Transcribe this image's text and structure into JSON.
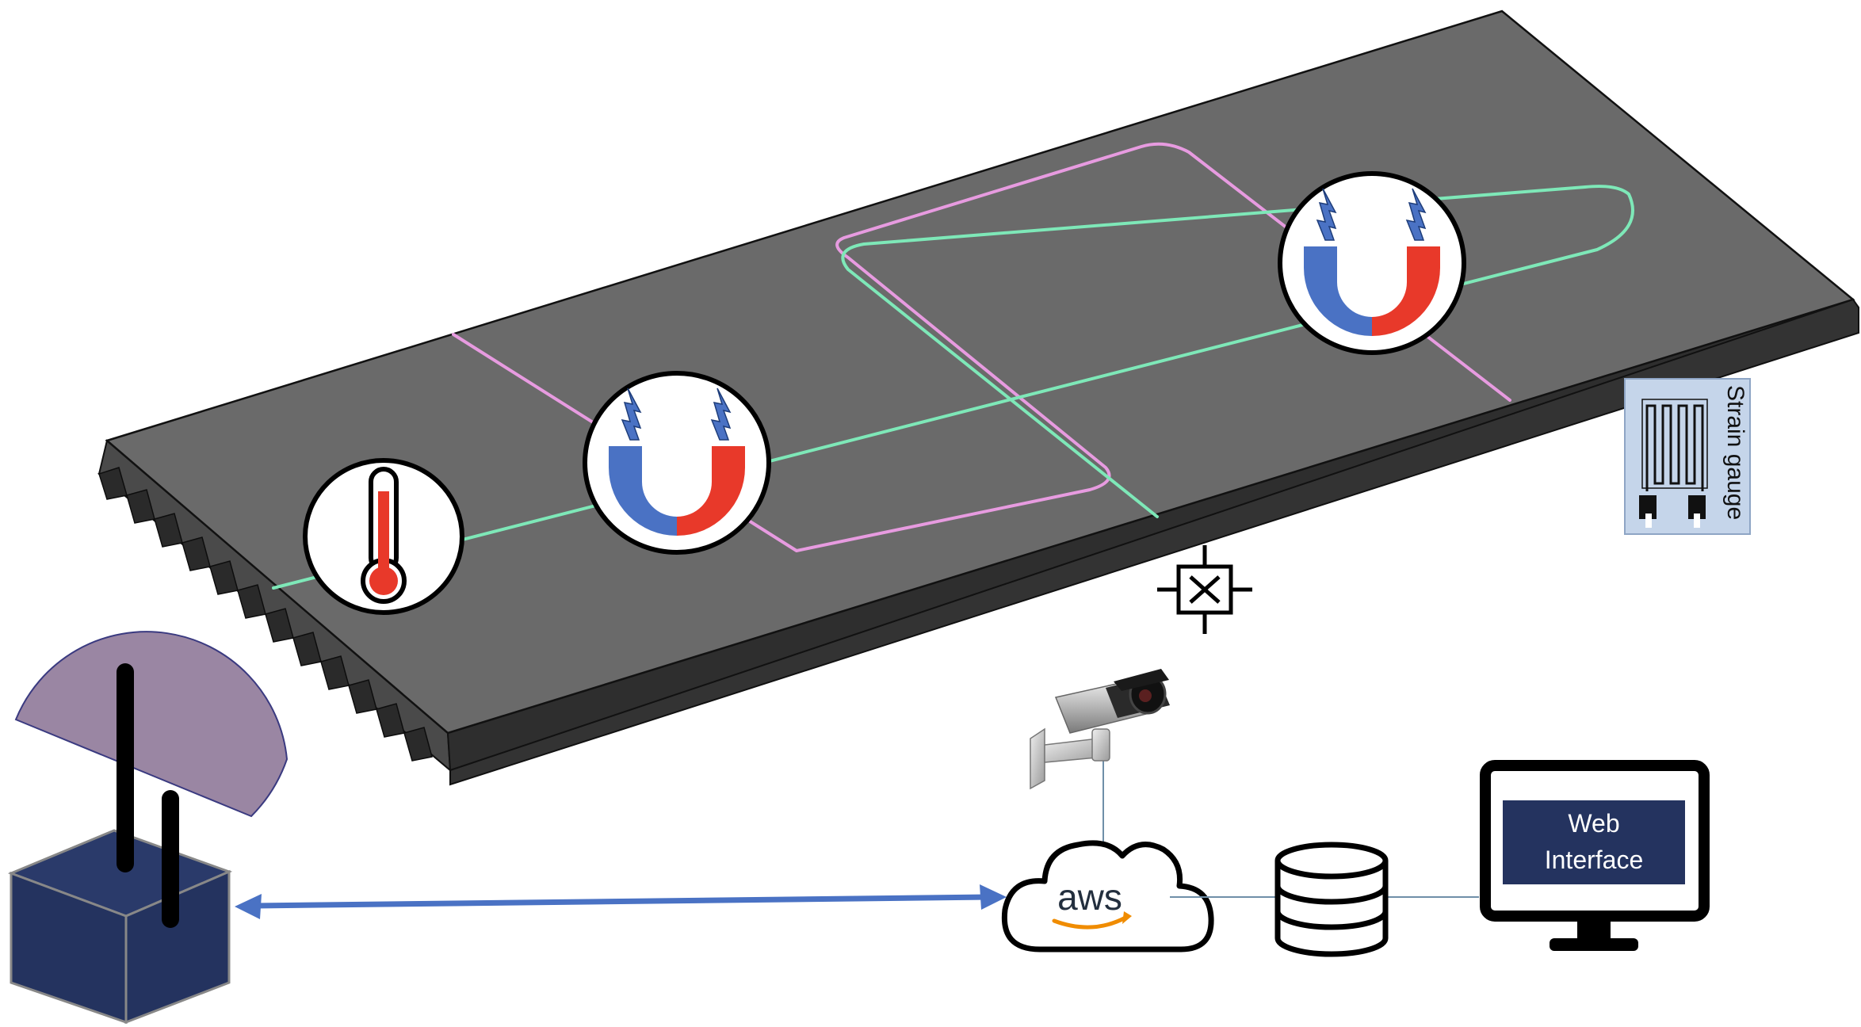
{
  "strain_gauge": {
    "label": "Strain gauge"
  },
  "monitor": {
    "line1": "Web",
    "line2": "Interface"
  },
  "cloud": {
    "label": "aws"
  },
  "colors": {
    "panel_top": "#6a6a6a",
    "panel_side": "#4a4a4a",
    "green_trace": "#7ee8b8",
    "pink_trace": "#e79be0",
    "magnet_blue": "#4a72c4",
    "magnet_red": "#e8392a",
    "gateway_box": "#24335f",
    "gateway_dome": "#9a86a3",
    "link_arrow": "#4a72c4",
    "monitor_screen": "#24335f"
  }
}
